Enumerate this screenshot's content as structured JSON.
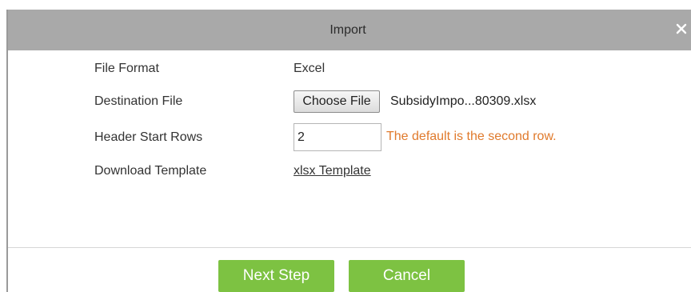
{
  "dialog": {
    "title": "Import",
    "close_icon": "close-icon"
  },
  "form": {
    "file_format": {
      "label": "File Format",
      "value": "Excel"
    },
    "destination_file": {
      "label": "Destination File",
      "button_label": "Choose File",
      "file_name": "SubsidyImpo...80309.xlsx"
    },
    "header_start_rows": {
      "label": "Header Start Rows",
      "value": "2",
      "hint": "The default is the second row."
    },
    "download_template": {
      "label": "Download Template",
      "link_text": "xlsx Template"
    }
  },
  "footer": {
    "next_label": "Next Step",
    "cancel_label": "Cancel"
  },
  "colors": {
    "title_bar": "#a9a9a9",
    "button_green": "#7dc242",
    "hint_orange": "#e07a2c"
  }
}
